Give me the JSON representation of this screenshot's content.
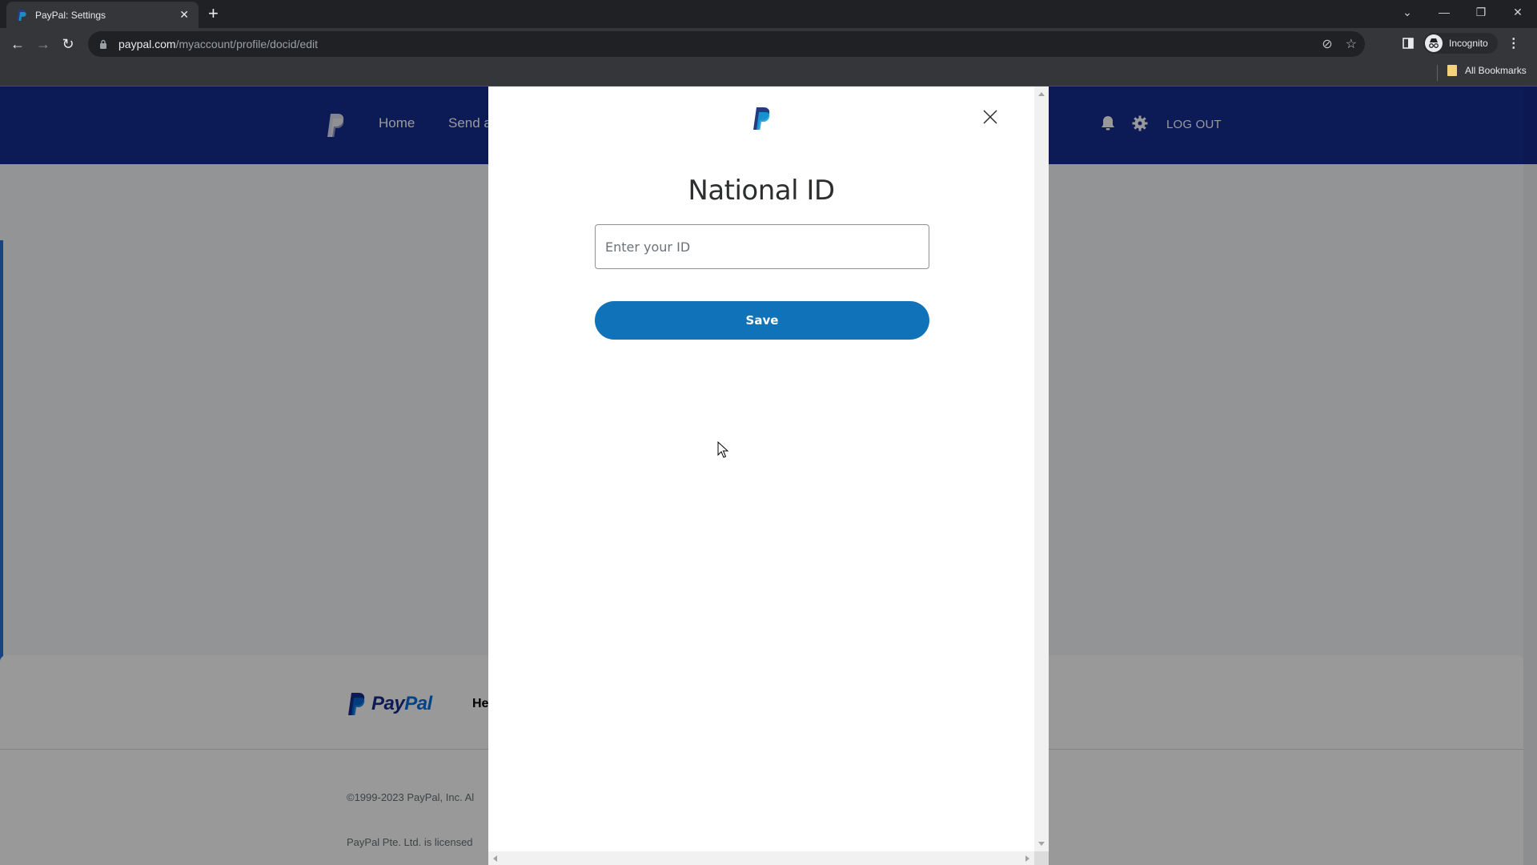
{
  "browser": {
    "tab_title": "PayPal: Settings",
    "url_domain": "paypal.com",
    "url_path": "/myaccount/profile/docid/edit",
    "profile_label": "Incognito",
    "bookmarks_label": "All Bookmarks"
  },
  "header": {
    "nav": [
      "Home",
      "Send a"
    ],
    "logout_label": "LOG OUT"
  },
  "modal": {
    "title": "National ID",
    "input_placeholder": "Enter your ID",
    "input_value": "",
    "save_label": "Save"
  },
  "footer": {
    "brand_pay": "Pay",
    "brand_pal": "Pal",
    "help_partial": "He",
    "copyright": "©1999-2023 PayPal, Inc. Al",
    "licensed": "PayPal Pte. Ltd. is licensed"
  },
  "colors": {
    "header_bg": "#142c8e",
    "save_button": "#1072b8",
    "overlay": "rgba(0,0,0,0.4)"
  }
}
